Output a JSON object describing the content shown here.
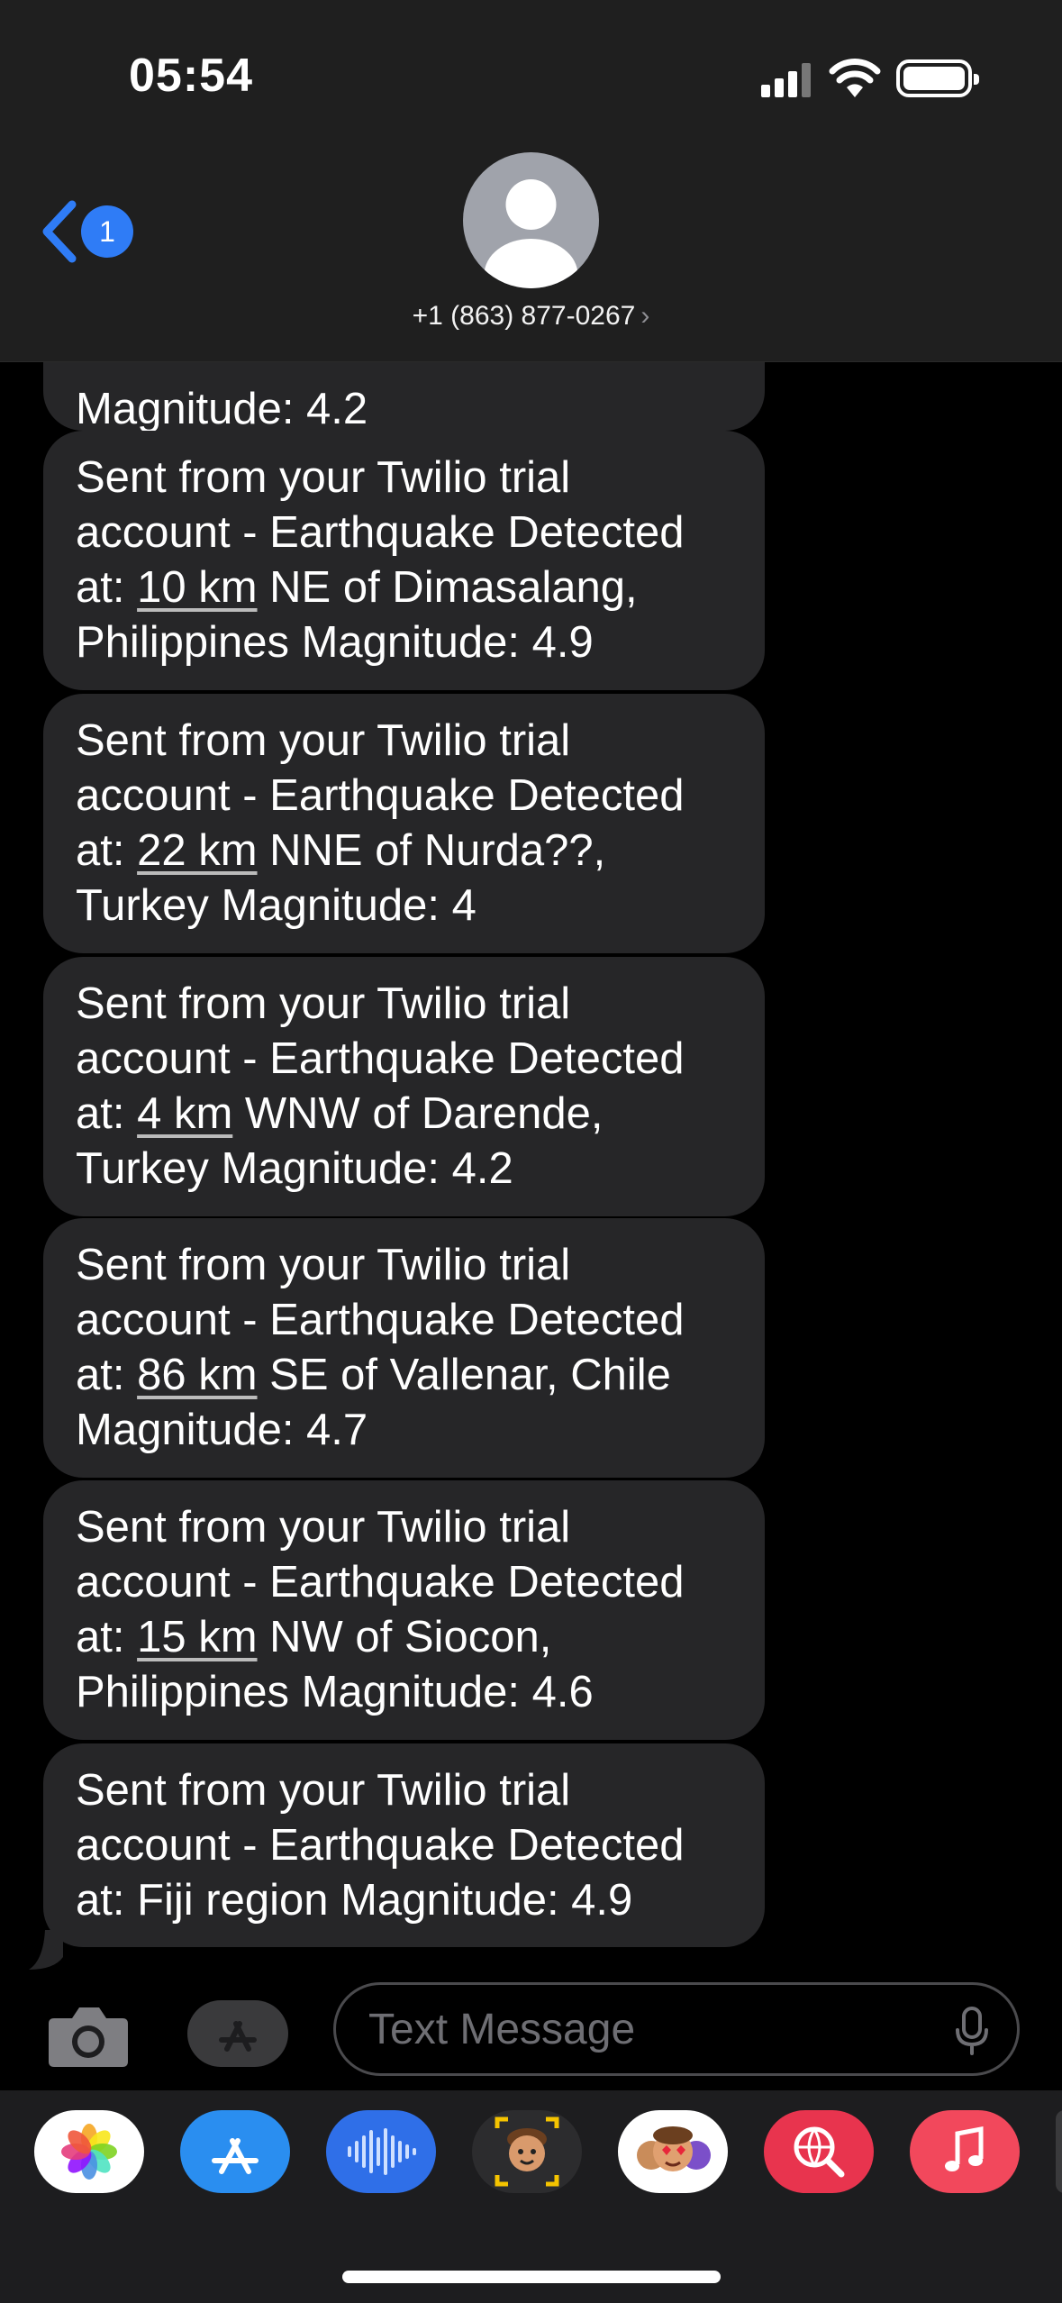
{
  "status_bar": {
    "time": "05:54"
  },
  "header": {
    "back_badge_count": "1",
    "contact_name": "+1 (863) 877-0267",
    "chevron": "›"
  },
  "messages": {
    "partial_top": "Magnitude: 4.2",
    "items": [
      {
        "before": "Sent from your Twilio trial account - Earthquake Detected at: ",
        "link": "10 km",
        "after": " NE of Dimasalang, Philippines Magnitude: 4.9"
      },
      {
        "before": "Sent from your Twilio trial account - Earthquake Detected at: ",
        "link": "22 km",
        "after": " NNE of Nurda??, Turkey Magnitude: 4"
      },
      {
        "before": "Sent from your Twilio trial account - Earthquake Detected at: ",
        "link": "4 km",
        "after": " WNW of Darende, Turkey Magnitude: 4.2"
      },
      {
        "before": "Sent from your Twilio trial account - Earthquake Detected at: ",
        "link": "86 km",
        "after": " SE of Vallenar, Chile Magnitude: 4.7"
      },
      {
        "before": "Sent from your Twilio trial account - Earthquake Detected at: ",
        "link": "15 km",
        "after": " NW of Siocon, Philippines Magnitude: 4.6"
      },
      {
        "before": "Sent from your Twilio trial account - Earthquake Detected at: Fiji region Magnitude: 4.9",
        "link": "",
        "after": ""
      }
    ]
  },
  "composer": {
    "placeholder": "Text Message"
  },
  "app_drawer": {
    "apps": [
      "photos-app-icon",
      "app-store-app-icon",
      "audio-messages-app-icon",
      "memoji-app-icon",
      "memoji-stickers-app-icon",
      "search-images-app-icon",
      "music-app-icon"
    ]
  },
  "colors": {
    "accent": "#2f7cf6",
    "bubble": "#262628",
    "header": "#1f1f1f"
  }
}
